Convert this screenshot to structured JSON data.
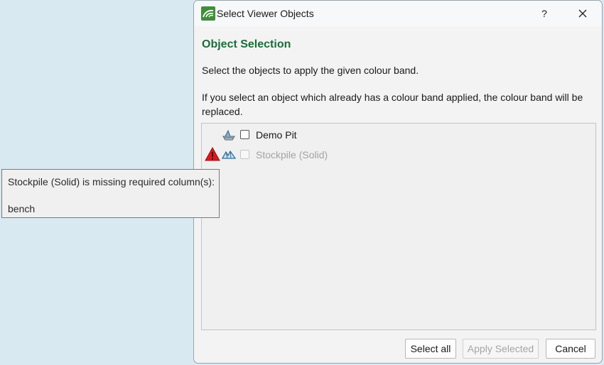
{
  "dialog": {
    "title": "Select Viewer Objects",
    "help_label": "?",
    "section_title": "Object Selection",
    "description": "Select the objects to apply the given colour band.",
    "note": "If you select an object which already has a colour band applied, the colour band will be replaced."
  },
  "objects": [
    {
      "label": "Demo Pit",
      "icon": "pit-icon",
      "enabled": true,
      "checked": false,
      "warning": false
    },
    {
      "label": "Stockpile (Solid)",
      "icon": "solid-icon",
      "enabled": false,
      "checked": false,
      "warning": true
    }
  ],
  "buttons": {
    "select_all": "Select all",
    "apply_selected": "Apply Selected",
    "cancel": "Cancel"
  },
  "tooltip": {
    "line1": "Stockpile (Solid) is missing required column(s):",
    "line2": "bench"
  },
  "colors": {
    "accent_green": "#1e6b3a",
    "warning_red": "#e0161c",
    "desktop_bg": "#d9e9f2"
  }
}
